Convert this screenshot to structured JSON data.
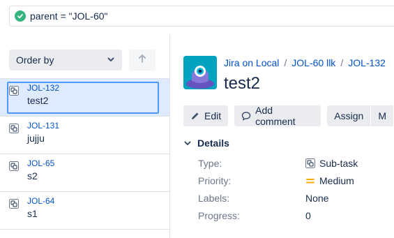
{
  "search": {
    "query": "parent = \"JOL-60\""
  },
  "list": {
    "order_label": "Order by",
    "issues": [
      {
        "key": "JOL-132",
        "summary": "test2"
      },
      {
        "key": "JOL-131",
        "summary": "jujju"
      },
      {
        "key": "JOL-65",
        "summary": "s2"
      },
      {
        "key": "JOL-64",
        "summary": "s1"
      }
    ]
  },
  "issue": {
    "breadcrumb": [
      "Jira on Local",
      "JOL-60 llk",
      "JOL-132"
    ],
    "title": "test2",
    "actions": {
      "edit": "Edit",
      "comment": "Add comment",
      "assign": "Assign",
      "more": "M"
    },
    "details": {
      "heading": "Details",
      "type_label": "Type:",
      "type_value": "Sub-task",
      "priority_label": "Priority:",
      "priority_value": "Medium",
      "labels_label": "Labels:",
      "labels_value": "None",
      "progress_label": "Progress:",
      "progress_value": "0"
    }
  },
  "colors": {
    "accent": "#0052cc",
    "selected_bg": "#deebff",
    "success": "#36b37e",
    "priority_medium": "#ffab00"
  }
}
